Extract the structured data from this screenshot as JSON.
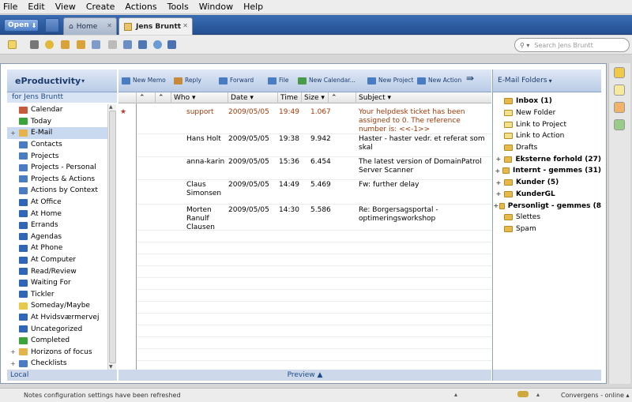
{
  "menu": [
    "File",
    "Edit",
    "View",
    "Create",
    "Actions",
    "Tools",
    "Window",
    "Help"
  ],
  "tabbar": {
    "open_label": "Open",
    "tabs": [
      {
        "label": "Home"
      },
      {
        "label": "Jens Bruntt"
      }
    ]
  },
  "search": {
    "placeholder": "Search Jens Bruntt"
  },
  "left": {
    "title": "eProductivity",
    "subtitle": "for Jens Bruntt",
    "bottom": "Local",
    "items": [
      {
        "label": "Calendar",
        "icon": "calendar-icon",
        "color": "#c75a3a",
        "exp": ""
      },
      {
        "label": "Today",
        "icon": "flag-icon",
        "color": "#3aa33a",
        "exp": ""
      },
      {
        "label": "E-Mail",
        "icon": "mail-icon",
        "color": "#e6b34a",
        "exp": "+"
      },
      {
        "label": "Contacts",
        "icon": "contacts-icon",
        "color": "#4a7cc4",
        "exp": ""
      },
      {
        "label": "Projects",
        "icon": "projects-icon",
        "color": "#4a7cc4",
        "exp": ""
      },
      {
        "label": "Projects - Personal",
        "icon": "projects-icon",
        "color": "#4a7cc4",
        "exp": ""
      },
      {
        "label": "Projects & Actions",
        "icon": "projects-icon",
        "color": "#4a7cc4",
        "exp": ""
      },
      {
        "label": "Actions by Context",
        "icon": "actions-icon",
        "color": "#4a7cc4",
        "exp": ""
      },
      {
        "label": "At Office",
        "icon": "office-icon",
        "color": "#2f66b8",
        "exp": ""
      },
      {
        "label": "At Home",
        "icon": "home-icon",
        "color": "#2f66b8",
        "exp": ""
      },
      {
        "label": "Errands",
        "icon": "car-icon",
        "color": "#2f66b8",
        "exp": ""
      },
      {
        "label": "Agendas",
        "icon": "agenda-icon",
        "color": "#2f66b8",
        "exp": ""
      },
      {
        "label": "At Phone",
        "icon": "phone-icon",
        "color": "#2f66b8",
        "exp": ""
      },
      {
        "label": "At Computer",
        "icon": "computer-icon",
        "color": "#2f66b8",
        "exp": ""
      },
      {
        "label": "Read/Review",
        "icon": "book-icon",
        "color": "#2f66b8",
        "exp": ""
      },
      {
        "label": "Waiting For",
        "icon": "clock-icon",
        "color": "#2f66b8",
        "exp": ""
      },
      {
        "label": "Tickler",
        "icon": "tickler-icon",
        "color": "#2f66b8",
        "exp": ""
      },
      {
        "label": "Someday/Maybe",
        "icon": "lightbulb-icon",
        "color": "#e6c84a",
        "exp": ""
      },
      {
        "label": "At Hvidsværmervej",
        "icon": "location-icon",
        "color": "#2f66b8",
        "exp": ""
      },
      {
        "label": "Uncategorized",
        "icon": "question-icon",
        "color": "#2f66b8",
        "exp": ""
      },
      {
        "label": "Completed",
        "icon": "check-icon",
        "color": "#3aa33a",
        "exp": ""
      },
      {
        "label": "Horizons of focus",
        "icon": "horizons-icon",
        "color": "#e6b34a",
        "exp": "+"
      },
      {
        "label": "Checklists",
        "icon": "checklist-icon",
        "color": "#4a7cc4",
        "exp": "+"
      }
    ]
  },
  "center": {
    "toolbar": [
      {
        "label": "New Memo",
        "color": "#4a7cc4"
      },
      {
        "label": "Reply",
        "color": "#c78a3a"
      },
      {
        "label": "Forward",
        "color": "#4a7cc4"
      },
      {
        "label": "File",
        "color": "#4a7cc4"
      },
      {
        "label": "New Calendar...",
        "color": "#4a9a4a"
      },
      {
        "label": "New Project",
        "color": "#4a7cc4"
      },
      {
        "label": "New Action",
        "color": "#4a7cc4"
      }
    ],
    "columns": {
      "who": "Who",
      "date": "Date",
      "time": "Time",
      "size": "Size",
      "subject": "Subject"
    },
    "rows": [
      {
        "star": "★",
        "who": "support",
        "date": "2009/05/05",
        "time": "19:49",
        "size": "1.067",
        "subject": "Your helpdesk ticket has been assigned to 0. The reference number is: <<-1>>",
        "color": "#a33a0a",
        "bold": false
      },
      {
        "star": "",
        "who": "Hans Holt",
        "date": "2009/05/05",
        "time": "19:38",
        "size": "9.942",
        "subject": "Haster - haster vedr. et referat som skal",
        "color": "#000000",
        "bold": false
      },
      {
        "star": "",
        "who": "anna-karin",
        "date": "2009/05/05",
        "time": "15:36",
        "size": "6.454",
        "subject": "The latest version of DomainPatrol Server Scanner",
        "color": "#000000",
        "bold": false
      },
      {
        "star": "",
        "who": "Claus Simonsen",
        "date": "2009/05/05",
        "time": "14:49",
        "size": "5.469",
        "subject": "Fw: further delay",
        "color": "#000000",
        "bold": false
      },
      {
        "star": "",
        "who": "Morten Ranulf Clausen",
        "date": "2009/05/05",
        "time": "14:30",
        "size": "5.586",
        "subject": "Re: Borgersagsportal - optimeringsworkshop",
        "color": "#000000",
        "bold": false
      }
    ],
    "preview": "Preview ▲"
  },
  "right": {
    "title": "E-Mail Folders",
    "folders": [
      {
        "label": "Inbox (1)",
        "bold": true,
        "exp": "",
        "icon": "inbox-icon"
      },
      {
        "label": "New Folder",
        "bold": false,
        "exp": "",
        "icon": "new-folder-icon"
      },
      {
        "label": "Link to Project",
        "bold": false,
        "exp": "",
        "icon": "link-icon"
      },
      {
        "label": "Link to Action",
        "bold": false,
        "exp": "",
        "icon": "link-icon"
      },
      {
        "label": "Drafts",
        "bold": false,
        "exp": "",
        "icon": "folder-icon"
      },
      {
        "label": "Eksterne forhold (27)",
        "bold": true,
        "exp": "+",
        "icon": "folder-icon"
      },
      {
        "label": "Internt - gemmes (31)",
        "bold": true,
        "exp": "+",
        "icon": "folder-icon"
      },
      {
        "label": "Kunder (5)",
        "bold": true,
        "exp": "+",
        "icon": "folder-icon"
      },
      {
        "label": "KunderGL",
        "bold": true,
        "exp": "+",
        "icon": "folder-icon"
      },
      {
        "label": "Personligt - gemmes (8",
        "bold": true,
        "exp": "+",
        "icon": "folder-icon"
      },
      {
        "label": "Slettes",
        "bold": false,
        "exp": "",
        "icon": "folder-icon"
      },
      {
        "label": "Spam",
        "bold": false,
        "exp": "",
        "icon": "folder-icon"
      }
    ]
  },
  "status": {
    "message": "Notes configuration settings have been refreshed",
    "location": "Convergens - online"
  }
}
